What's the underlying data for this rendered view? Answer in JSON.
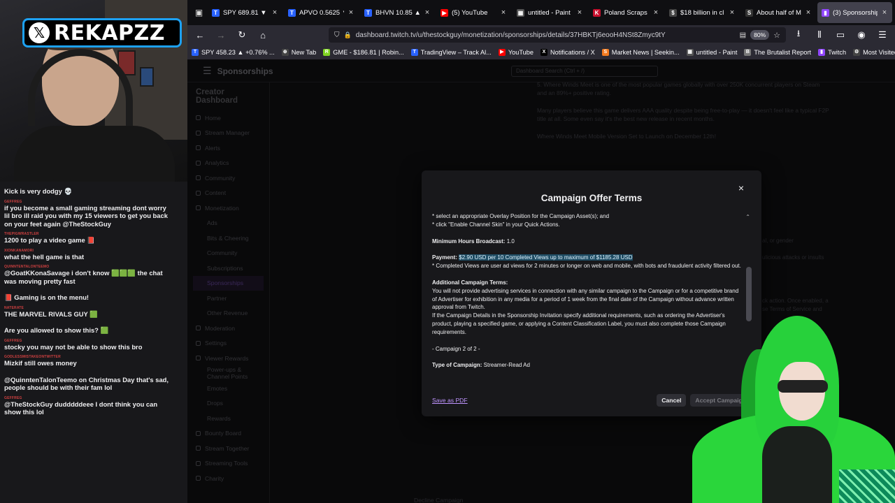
{
  "overlay": {
    "logo_text": "REKAPZZ"
  },
  "chat": {
    "messages": [
      {
        "text": "Kick is very dodgy 💀"
      },
      {
        "text": "if you become a small gaming streaming dont worry lil bro ill raid you with my 15 viewers to get you back on your feet again @TheStockGuy"
      },
      {
        "text": "1200 to play a video game 📕"
      },
      {
        "text": "what the hell game is that"
      },
      {
        "text": "@GoatKKonaSavage i don't know 🟩🟩🟩 the chat was moving pretty fast"
      },
      {
        "text": "📕 Gaming is on the menu!"
      },
      {
        "text": "THE MARVEL RIVALS GUY 🟩"
      },
      {
        "text": "Are you allowed to show this? 🟩"
      },
      {
        "text": "stocky you may not be able to show this bro"
      },
      {
        "text": "Mizkif still owes money"
      },
      {
        "text": "@QuinntenTalonTeemo on Christmas Day that's sad, people should be with their fam lol"
      },
      {
        "text": "@TheStockGuy dudddddeee I dont think you can show this lol"
      }
    ],
    "usernames": [
      "",
      "GEFFREG",
      "THEPIGWRASTLER",
      "XIONKANAMORI",
      "QUINNTENTALONTEEMO",
      "",
      "NATERATE",
      "",
      "GEFFREG",
      "GODLESSMISTAKEONTWITTER",
      "",
      "GEFFREG"
    ]
  },
  "browser": {
    "tabs": [
      {
        "label": "SPY 689.81 ▼ -",
        "fav": "T",
        "color": "#2962ff"
      },
      {
        "label": "APVO 0.5625 ▼",
        "fav": "T",
        "color": "#2962ff"
      },
      {
        "label": "BHVN 10.85 ▲",
        "fav": "T",
        "color": "#2962ff"
      },
      {
        "label": "(5) YouTube",
        "fav": "▶",
        "color": "#ff0000"
      },
      {
        "label": "untitled - Paint",
        "fav": "▦",
        "color": "#555"
      },
      {
        "label": "Poland Scraps Ir",
        "fav": "K",
        "color": "#c8102e"
      },
      {
        "label": "$18 billion in cl",
        "fav": "$",
        "color": "#444"
      },
      {
        "label": "About half of M",
        "fav": "S",
        "color": "#333"
      },
      {
        "label": "(3) Sponsorship",
        "fav": "▮",
        "color": "#9146ff"
      }
    ],
    "url": "dashboard.twitch.tv/u/thestockguy/monetization/sponsorships/details/37HBKTj6eooH4NSt8Zmyc9tY",
    "zoom": "80%",
    "bookmarks": [
      {
        "label": "SPY 458.23 ▲ +0.76% ...",
        "fav": "T",
        "color": "#2962ff"
      },
      {
        "label": "New Tab",
        "fav": "⊕",
        "color": "#444"
      },
      {
        "label": "GME - $186.81 | Robin...",
        "fav": "R",
        "color": "#7fd321"
      },
      {
        "label": "TradingView – Track Al...",
        "fav": "T",
        "color": "#2962ff"
      },
      {
        "label": "YouTube",
        "fav": "▶",
        "color": "#ff0000"
      },
      {
        "label": "Notifications / X",
        "fav": "X",
        "color": "#000"
      },
      {
        "label": "Market News | Seekin...",
        "fav": "S",
        "color": "#f37b20"
      },
      {
        "label": "untitled - Paint",
        "fav": "▦",
        "color": "#555"
      },
      {
        "label": "The Brutalist Report",
        "fav": "B",
        "color": "#777"
      },
      {
        "label": "Twitch",
        "fav": "▮",
        "color": "#9146ff"
      },
      {
        "label": "Most Visited",
        "fav": "⚙",
        "color": "#444"
      }
    ]
  },
  "dashboard": {
    "title": "Sponsorships",
    "search_placeholder": "Dashboard Search (Ctrl + /)",
    "sidebar_title": "Creator Dashboard",
    "sidebar_items": [
      {
        "label": "Home",
        "sub": false
      },
      {
        "label": "Stream Manager",
        "sub": false
      },
      {
        "label": "Alerts",
        "sub": false
      },
      {
        "label": "Analytics",
        "sub": false
      },
      {
        "label": "Community",
        "sub": false
      },
      {
        "label": "Content",
        "sub": false
      },
      {
        "label": "Monetization",
        "sub": false
      },
      {
        "label": "Ads",
        "sub": true
      },
      {
        "label": "Bits & Cheering",
        "sub": true
      },
      {
        "label": "Community",
        "sub": true
      },
      {
        "label": "Subscriptions",
        "sub": true
      },
      {
        "label": "Sponsorships",
        "sub": true
      },
      {
        "label": "Partner",
        "sub": true
      },
      {
        "label": "Other Revenue",
        "sub": true
      },
      {
        "label": "Moderation",
        "sub": false
      },
      {
        "label": "Settings",
        "sub": false
      },
      {
        "label": "Viewer Rewards",
        "sub": false
      },
      {
        "label": "Power-ups & Channel Points",
        "sub": true
      },
      {
        "label": "Emotes",
        "sub": true
      },
      {
        "label": "Drops",
        "sub": true
      },
      {
        "label": "Rewards",
        "sub": true
      },
      {
        "label": "Bounty Board",
        "sub": false
      },
      {
        "label": "Stream Together",
        "sub": false
      },
      {
        "label": "Streaming Tools",
        "sub": false
      },
      {
        "label": "Charity",
        "sub": false
      }
    ],
    "bg_lines": [
      "5. Where Winds Meet is one of the most popular games globally with over 250K concurrent players on Steam and an 89%+ positive rating.",
      "Many players believe this game delivers AAA quality despite being free-to-play — it doesn't feel like a typical F2P title at all. Some even say it's the best new release in recent months.",
      "Where Winds Meet Mobile Version Set to Launch on December 12th!"
    ],
    "decline_label": "Decline Campaign",
    "right_snippets": [
      "al, or gender",
      "ulicious attacks or insults",
      "ck action. Once enabled, a",
      "se Terms of Service and"
    ]
  },
  "modal": {
    "title": "Campaign Offer Terms",
    "close_label": "×",
    "lines": {
      "l1": "* select an appropriate Overlay Position for the Campaign Asset(s); and",
      "l2": "* click \"Enable Channel Skin\" in your Quick Actions.",
      "min_label": "Minimum Hours Broadcast:",
      "min_value": "1.0",
      "pay_label": "Payment:",
      "pay_value": "$2.90 USD per 10 Completed Views up to maximum of $1185.28 USD",
      "pay_note": "* Completed Views are user ad views for 2 minutes or longer on web and mobile, with bots and fraudulent activity filtered out.",
      "add_label": "Additional Campaign Terms:",
      "add_p1": "You will not provide advertising services in connection with any similar campaign to the Campaign or for a competitive brand of Advertiser for exhibition in any media for a period of 1 week from the final date of the Campaign without advance written approval from Twitch.",
      "add_p2": "If the Campaign Details in the Sponsorship Invitation specify additional requirements, such as ordering the Advertiser's product, playing a specified game, or applying a Content Classification Label, you must also complete those Campaign requirements.",
      "campaign_no": "- Campaign 2 of 2 -",
      "type_label": "Type of Campaign:",
      "type_value": "Streamer-Read Ad"
    },
    "save_pdf": "Save as PDF",
    "cancel": "Cancel",
    "accept": "Accept Campaign"
  }
}
